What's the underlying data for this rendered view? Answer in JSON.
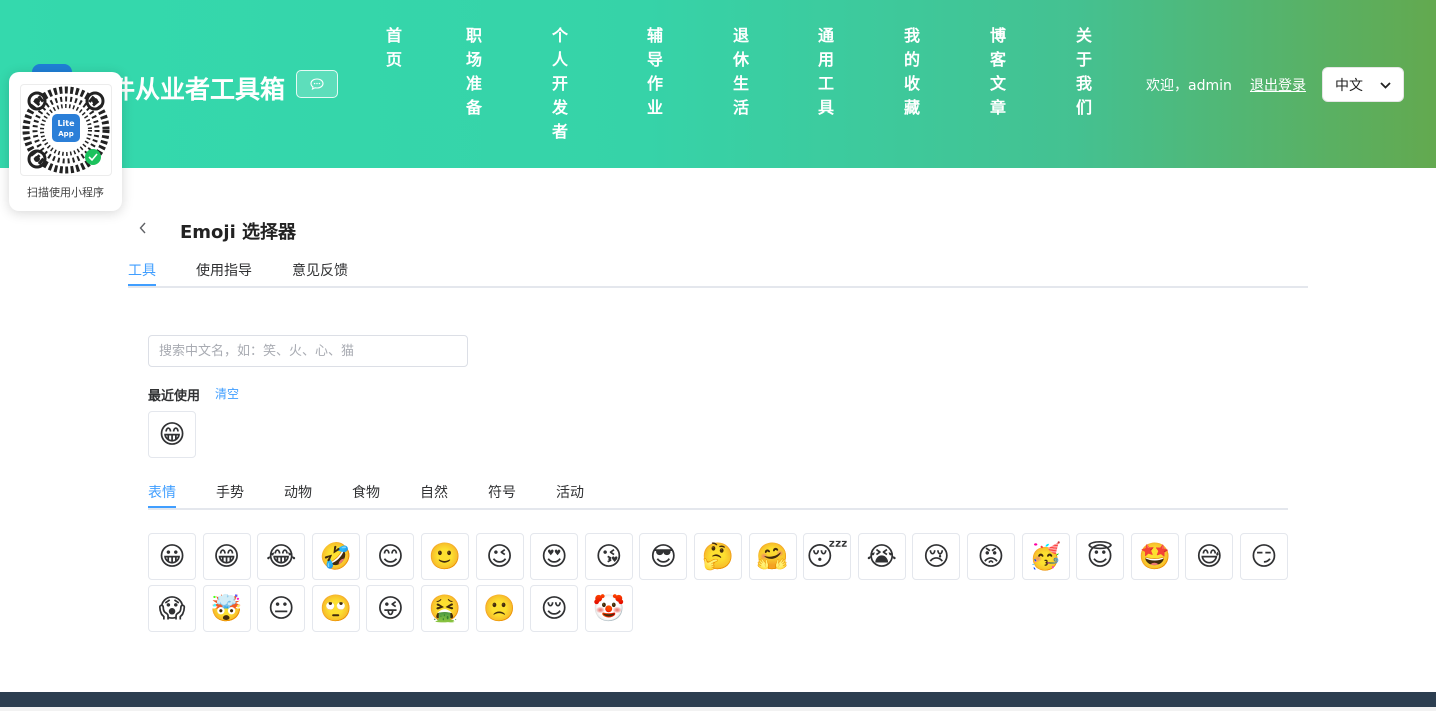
{
  "header": {
    "site_title": "件从业者工具箱",
    "logo_icon": "app-logo-icon",
    "chat_icon": "chat-bubble-icon",
    "nav": [
      {
        "label": "首页"
      },
      {
        "label": "职场准备"
      },
      {
        "label": "个人开发者"
      },
      {
        "label": "辅导作业"
      },
      {
        "label": "退休生活"
      },
      {
        "label": "通用工具"
      },
      {
        "label": "我的收藏"
      },
      {
        "label": "博客文章"
      },
      {
        "label": "关于我们"
      }
    ],
    "welcome": "欢迎，admin",
    "logout": "退出登录",
    "language": "中文",
    "gradient_colors": [
      "#34d9ad",
      "#63a94f"
    ]
  },
  "qr_popup": {
    "badge_text_line1": "Lite",
    "badge_text_line2": "App",
    "caption": "扫描使用小程序"
  },
  "page": {
    "title": "Emoji 选择器",
    "back_icon": "chevron-left-icon",
    "tabs": [
      {
        "label": "工具",
        "active": true
      },
      {
        "label": "使用指导",
        "active": false
      },
      {
        "label": "意见反馈",
        "active": false
      }
    ]
  },
  "tool": {
    "search_placeholder": "搜索中文名，如：笑、火、心、猫",
    "recent_label": "最近使用",
    "clear_label": "清空",
    "recent": [
      "😁"
    ],
    "categories": [
      {
        "label": "表情",
        "active": true
      },
      {
        "label": "手势",
        "active": false
      },
      {
        "label": "动物",
        "active": false
      },
      {
        "label": "食物",
        "active": false
      },
      {
        "label": "自然",
        "active": false
      },
      {
        "label": "符号",
        "active": false
      },
      {
        "label": "活动",
        "active": false
      }
    ],
    "emojis": [
      "😀",
      "😁",
      "😂",
      "🤣",
      "😊",
      "🙂",
      "😉",
      "😍",
      "😘",
      "😎",
      "🤔",
      "🤗",
      "😴",
      "😭",
      "😢",
      "😡",
      "🥳",
      "😇",
      "🤩",
      "😅",
      "😏",
      "😱",
      "🤯",
      "😐",
      "🙄",
      "😜",
      "🤮",
      "🙁",
      "😌",
      "🤡"
    ]
  },
  "colors": {
    "accent": "#409eff",
    "footer": "#2c3e50"
  }
}
